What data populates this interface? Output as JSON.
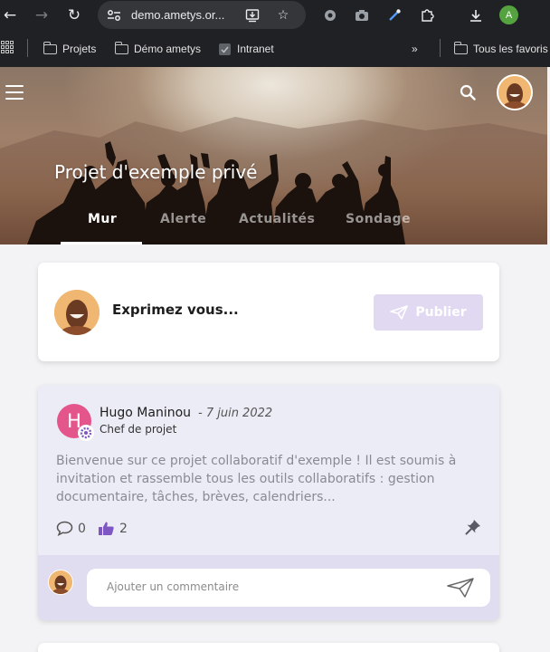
{
  "browser": {
    "url": "demo.ametys.or...",
    "profile_initial": "A",
    "bookmarks": [
      "Projets",
      "Démo ametys",
      "Intranet"
    ],
    "more_bookmarks": "»",
    "all_bookmarks": "Tous les favoris"
  },
  "header": {
    "project_title": "Projet d'exemple privé",
    "tabs": [
      {
        "label": "Mur",
        "active": true
      },
      {
        "label": "Alerte",
        "active": false
      },
      {
        "label": "Actualités",
        "active": false
      },
      {
        "label": "Sondage",
        "active": false
      }
    ]
  },
  "composer": {
    "prompt": "Exprimez vous...",
    "publish_label": "Publier"
  },
  "post": {
    "author_initial": "H",
    "author": "Hugo Maninou",
    "date": "- 7 juin 2022",
    "role": "Chef de projet",
    "body": "Bienvenue sur ce projet collaboratif d'exemple ! Il est soumis à invitation et rassemble tous les outils collaboratifs : gestion documentaire, tâches, brèves, calendriers...",
    "comments_count": "0",
    "likes_count": "2",
    "comment_placeholder": "Ajouter un commentaire"
  },
  "colors": {
    "accent": "#7e57c2",
    "publish_bg": "#e1d9f2",
    "avatar_h": "#e4558c"
  },
  "icons": [
    "menu-icon",
    "search-icon",
    "send-icon",
    "comment-icon",
    "thumbs-up-icon",
    "pin-icon",
    "gear-icon"
  ]
}
